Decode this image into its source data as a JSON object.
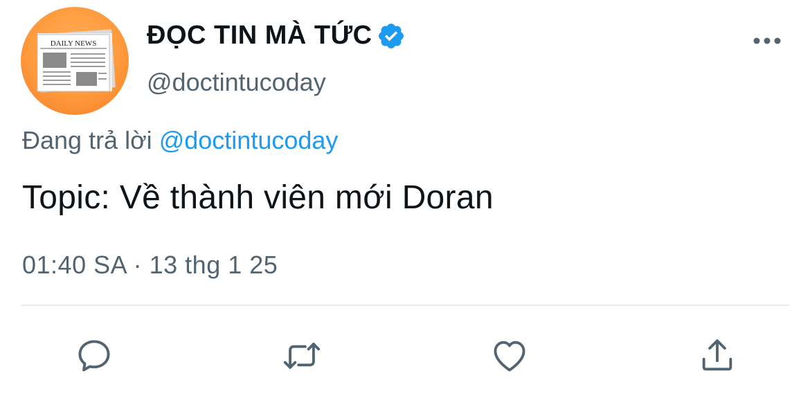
{
  "author": {
    "display_name": "ĐỌC TIN MÀ TỨC",
    "handle": "@doctintucoday",
    "avatar_text": "DAILY NEWS",
    "verified": true,
    "avatar_icon": "newspaper-icon"
  },
  "reply_context": {
    "prefix": "Đang trả lời",
    "mention": "@doctintucoday"
  },
  "tweet": {
    "text": "Topic: Về thành viên mới Doran",
    "timestamp": "01:40 SA · 13 thg 1 25"
  },
  "actions": [
    {
      "name": "reply",
      "icon": "comment-icon"
    },
    {
      "name": "retweet",
      "icon": "retweet-icon"
    },
    {
      "name": "like",
      "icon": "heart-icon"
    },
    {
      "name": "share",
      "icon": "share-icon"
    }
  ],
  "colors": {
    "accent": "#1d9bf0",
    "secondary_text": "#536471",
    "primary_text": "#0f1419",
    "icon": "#536471"
  }
}
